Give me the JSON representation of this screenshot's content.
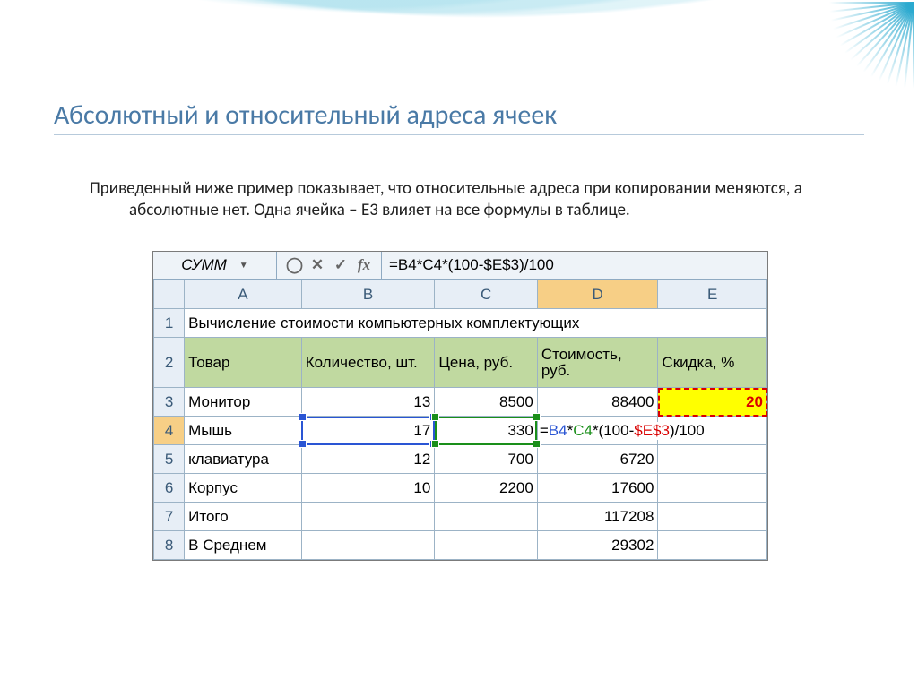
{
  "title": "Абсолютный и относительный адреса ячеек",
  "paragraph": "Приведенный ниже пример показывает, что относительные адреса при копировании меняются, а абсолютные нет. Одна ячейка – E3 влияет на все формулы в таблице.",
  "formula_bar": {
    "name_box": "СУММ",
    "cancel": "✕",
    "enter": "✓",
    "fx": "fx",
    "formula": "=B4*C4*(100-$E$3)/100"
  },
  "columns": [
    "A",
    "B",
    "C",
    "D",
    "E"
  ],
  "row_numbers": [
    "1",
    "2",
    "3",
    "4",
    "5",
    "6",
    "7",
    "8"
  ],
  "row1_merged": "Вычисление стоимости компьютерных комплектующих",
  "headers": {
    "A": "Товар",
    "B": "Количество, шт.",
    "C": "Цена, руб.",
    "D": "Стоимость, руб.",
    "E": "Скидка, %"
  },
  "cells": {
    "A3": "Монитор",
    "B3": "13",
    "C3": "8500",
    "D3": "88400",
    "E3": "20",
    "A4": "Мышь",
    "B4": "17",
    "C4": "330",
    "D4_parts": {
      "pre": "=",
      "b": "B4",
      "m1": "*",
      "c": "C4",
      "m2": "*(100-",
      "e": "$E$3",
      "post": ")/100"
    },
    "A5": "клавиатура",
    "B5": "12",
    "C5": "700",
    "D5": "6720",
    "A6": "Корпус",
    "B6": "10",
    "C6": "2200",
    "D6": "17600",
    "A7": "Итого",
    "D7": "117208",
    "A8": "В Среднем",
    "D8": "29302"
  }
}
